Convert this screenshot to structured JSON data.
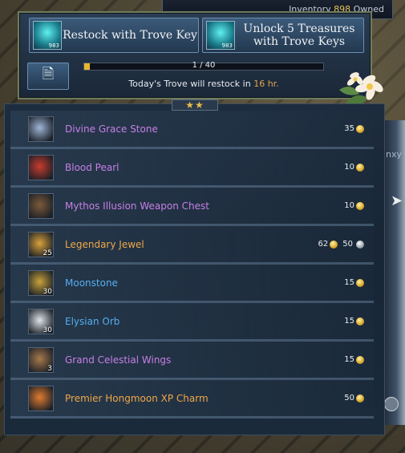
{
  "inventory": {
    "label": "Inventory",
    "count": "898",
    "owned": "Owned"
  },
  "buttons": {
    "restock": {
      "label": "Restock with Trove Key",
      "key_count": "983"
    },
    "unlock": {
      "label_line1": "Unlock 5 Treasures",
      "label_line2": "with Trove Keys",
      "key_count": "983"
    }
  },
  "progress": {
    "text": "1 / 40",
    "value": 1,
    "max": 40
  },
  "restock_info": {
    "prefix": "Today's Trove will restock in",
    "hours": "16 hr."
  },
  "stars": "★★",
  "side_text": "Inxy",
  "items": [
    {
      "name": "Divine Grace Stone",
      "color": "purple",
      "price": "35",
      "qty": "",
      "icon": "divine-grace-stone-icon",
      "icon_color": "#9fb6d8"
    },
    {
      "name": "Blood Pearl",
      "color": "purple",
      "price": "10",
      "qty": "",
      "icon": "blood-pearl-icon",
      "icon_color": "#c83b2e"
    },
    {
      "name": "Mythos Illusion Weapon Chest",
      "color": "purple",
      "price": "10",
      "qty": "",
      "icon": "weapon-chest-icon",
      "icon_color": "#7c5a3a"
    },
    {
      "name": "Legendary Jewel",
      "color": "orange",
      "price": "62",
      "price2": "50",
      "qty": "25",
      "icon": "legendary-jewel-icon",
      "icon_color": "#d9a13a"
    },
    {
      "name": "Moonstone",
      "color": "blue",
      "price": "15",
      "qty": "30",
      "icon": "moonstone-icon",
      "icon_color": "#c9a23a"
    },
    {
      "name": "Elysian Orb",
      "color": "blue",
      "price": "15",
      "qty": "30",
      "icon": "elysian-orb-icon",
      "icon_color": "#dfe4ea"
    },
    {
      "name": "Grand Celestial Wings",
      "color": "purple",
      "price": "15",
      "qty": "3",
      "icon": "celestial-wings-icon",
      "icon_color": "#a87a4c"
    },
    {
      "name": "Premier Hongmoon XP Charm",
      "color": "orange",
      "price": "50",
      "qty": "",
      "icon": "xp-charm-icon",
      "icon_color": "#e07b2e"
    }
  ]
}
